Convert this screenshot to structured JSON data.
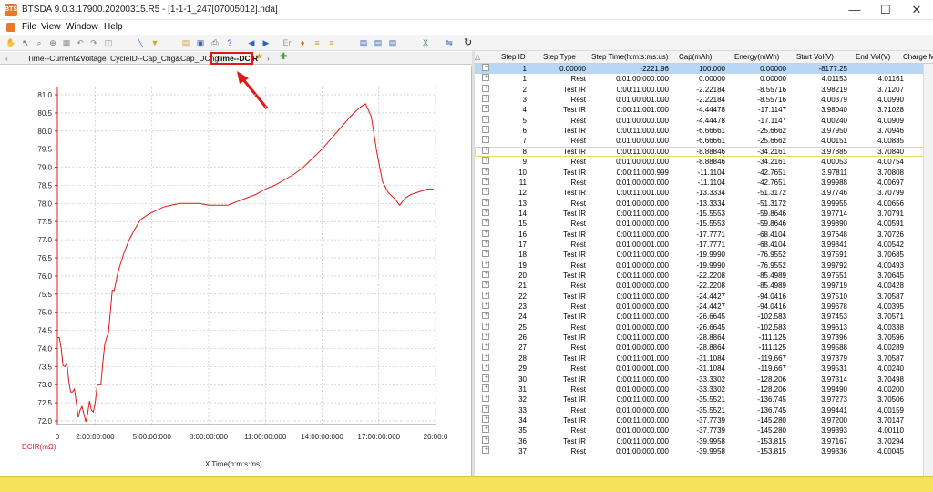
{
  "window": {
    "title": "BTSDA 9.0.3.17900.20200315.R5 - [1-1-1_247[07005012].nda]",
    "icon_label": "BTS",
    "minimize": "—",
    "maximize": "☐",
    "close": "✕"
  },
  "menu": [
    "File",
    "View",
    "Window",
    "Help"
  ],
  "tabs": {
    "items": [
      "Time--Current&Voltage",
      "CycleID--Cap_Chg&Cap_DChg",
      "Time--DCIR"
    ],
    "active": "Time--DCIR"
  },
  "chart_data": {
    "type": "line",
    "xlabel": "X   Time(h:m:s:ms)",
    "ylabel": "DCIR(mΩ)",
    "xlim": [
      0,
      20
    ],
    "ylim": [
      72.0,
      81.0
    ],
    "x_ticks": [
      "0",
      "2:00:00:000",
      "5:00:00:000",
      "8:00:00:000",
      "11:00:00:000",
      "14:00:00:000",
      "17:00:00:000",
      "20:00:0"
    ],
    "y_ticks": [
      "81.0",
      "80.5",
      "80.0",
      "79.5",
      "79.0",
      "78.5",
      "78.0",
      "77.5",
      "77.0",
      "76.5",
      "76.0",
      "75.5",
      "75.0",
      "74.5",
      "74.0",
      "73.5",
      "73.0",
      "72.5",
      "72.0"
    ],
    "series": [
      {
        "color": "#e01818",
        "x": [
          0,
          0.2,
          0.4,
          0.6,
          0.8,
          1.0,
          1.2,
          1.4,
          1.6,
          1.8,
          2.0,
          2.2,
          2.4,
          2.6,
          2.8,
          3.0,
          3.2,
          3.5,
          3.8,
          4.1,
          4.4,
          4.8,
          5.2,
          5.6,
          6.0,
          6.5,
          7.0,
          7.5,
          8.0,
          8.5,
          9.0,
          9.5,
          10.0,
          10.5,
          11.0,
          11.5,
          12.0,
          12.5,
          13.0,
          13.5,
          14.0,
          14.5,
          15.0,
          15.5,
          16.0,
          16.3,
          16.6,
          16.9,
          17.2,
          17.5,
          17.7,
          17.9,
          18.1,
          18.4,
          18.7,
          19.0,
          19.3,
          19.6,
          19.9
        ],
        "y": [
          74.3,
          74.0,
          73.5,
          73.1,
          72.8,
          72.5,
          72.3,
          72.2,
          72.2,
          72.3,
          72.5,
          73.0,
          73.6,
          74.3,
          75.0,
          75.6,
          76.1,
          76.6,
          77.0,
          77.3,
          77.55,
          77.7,
          77.8,
          77.9,
          77.95,
          78.0,
          78.0,
          78.0,
          77.95,
          77.95,
          77.95,
          78.05,
          78.15,
          78.25,
          78.4,
          78.5,
          78.65,
          78.8,
          79.0,
          79.25,
          79.5,
          79.8,
          80.1,
          80.4,
          80.65,
          80.75,
          80.4,
          79.4,
          78.6,
          78.3,
          78.2,
          78.1,
          77.95,
          78.15,
          78.25,
          78.3,
          78.35,
          78.4,
          78.4
        ]
      }
    ]
  },
  "grid": {
    "columns": [
      "Step ID",
      "Step Type",
      "Step Time(h:m:s:ms:us)",
      "Cap(mAh)",
      "Energy(mWh)",
      "Start Vol(V)",
      "End Vol(V)",
      "Charge M"
    ],
    "rows": [
      [
        "1",
        "0.00000",
        "-2221.96",
        "100.000",
        "0.00000",
        "-8177.25",
        ""
      ],
      [
        "1",
        "Rest",
        "0:01:00:000.000",
        "0.00000",
        "0.00000",
        "4.01153",
        "4.01161"
      ],
      [
        "2",
        "Test IR",
        "0:00:11:000.000",
        "-2.22184",
        "-8.55716",
        "3.98219",
        "3.71207"
      ],
      [
        "3",
        "Rest",
        "0:01:00:001.000",
        "-2.22184",
        "-8.55716",
        "4.00379",
        "4.00990"
      ],
      [
        "4",
        "Test IR",
        "0:00:11:001.000",
        "-4.44478",
        "-17.1147",
        "3.98040",
        "3.71028"
      ],
      [
        "5",
        "Rest",
        "0:01:00:000.000",
        "-4.44478",
        "-17.1147",
        "4.00240",
        "4.00909"
      ],
      [
        "6",
        "Test IR",
        "0:00:11:000.000",
        "-6.66661",
        "-25.6662",
        "3.97950",
        "3.70946"
      ],
      [
        "7",
        "Rest",
        "0:01:00:000.000",
        "-6.66661",
        "-25.6662",
        "4.00151",
        "4.00835"
      ],
      [
        "8",
        "Test IR",
        "0:00:11:000.000",
        "-8.88846",
        "-34.2161",
        "3.97885",
        "3.70840"
      ],
      [
        "9",
        "Rest",
        "0:01:00:000.000",
        "-8.88846",
        "-34.2161",
        "4.00053",
        "4.00754"
      ],
      [
        "10",
        "Test IR",
        "0:00:11:000.999",
        "-11.1104",
        "-42.7651",
        "3.97811",
        "3.70808"
      ],
      [
        "11",
        "Rest",
        "0:01:00:000.000",
        "-11.1104",
        "-42.7651",
        "3.99988",
        "4.00697"
      ],
      [
        "12",
        "Test IR",
        "0:00:11:001.000",
        "-13.3334",
        "-51.3172",
        "3.97746",
        "3.70799"
      ],
      [
        "13",
        "Rest",
        "0:01:00:000.000",
        "-13.3334",
        "-51.3172",
        "3.99955",
        "4.00656"
      ],
      [
        "14",
        "Test IR",
        "0:00:11:000.000",
        "-15.5553",
        "-59.8646",
        "3.97714",
        "3.70791"
      ],
      [
        "15",
        "Rest",
        "0:01:00:000.000",
        "-15.5553",
        "-59.8646",
        "3.99890",
        "4.00591"
      ],
      [
        "16",
        "Test IR",
        "0:00:11:000.000",
        "-17.7771",
        "-68.4104",
        "3.97648",
        "3.70726"
      ],
      [
        "17",
        "Rest",
        "0:01:00:001.000",
        "-17.7771",
        "-68.4104",
        "3.99841",
        "4.00542"
      ],
      [
        "18",
        "Test IR",
        "0:00:11:000.000",
        "-19.9990",
        "-76.9552",
        "3.97591",
        "3.70685"
      ],
      [
        "19",
        "Rest",
        "0:01:00:000.000",
        "-19.9990",
        "-76.9552",
        "3.99792",
        "4.00493"
      ],
      [
        "20",
        "Test IR",
        "0:00:11:000.000",
        "-22.2208",
        "-85.4989",
        "3.97551",
        "3.70645"
      ],
      [
        "21",
        "Rest",
        "0:01:00:000.000",
        "-22.2208",
        "-85.4989",
        "3.99719",
        "4.00428"
      ],
      [
        "22",
        "Test IR",
        "0:00:11:000.000",
        "-24.4427",
        "-94.0416",
        "3.97510",
        "3.70587"
      ],
      [
        "23",
        "Rest",
        "0:01:00:000.000",
        "-24.4427",
        "-94.0416",
        "3.99678",
        "4.00395"
      ],
      [
        "24",
        "Test IR",
        "0:00:11:000.000",
        "-26.6645",
        "-102.583",
        "3.97453",
        "3.70571"
      ],
      [
        "25",
        "Rest",
        "0:01:00:000.000",
        "-26.6645",
        "-102.583",
        "3.99613",
        "4.00338"
      ],
      [
        "26",
        "Test IR",
        "0:00:11:000.000",
        "-28.8864",
        "-111.125",
        "3.97396",
        "3.70596"
      ],
      [
        "27",
        "Rest",
        "0:01:00:000.000",
        "-28.8864",
        "-111.125",
        "3.99588",
        "4.00289"
      ],
      [
        "28",
        "Test IR",
        "0:00:11:001.000",
        "-31.1084",
        "-119.667",
        "3.97379",
        "3.70587"
      ],
      [
        "29",
        "Rest",
        "0:01:00:001.000",
        "-31.1084",
        "-119.667",
        "3.99531",
        "4.00240"
      ],
      [
        "30",
        "Test IR",
        "0:00:11:000.000",
        "-33.3302",
        "-128.206",
        "3.97314",
        "3.70498"
      ],
      [
        "31",
        "Rest",
        "0:01:00:000.000",
        "-33.3302",
        "-128.206",
        "3.99490",
        "4.00200"
      ],
      [
        "32",
        "Test IR",
        "0:00:11:000.000",
        "-35.5521",
        "-136.745",
        "3.97273",
        "3.70506"
      ],
      [
        "33",
        "Rest",
        "0:01:00:000.000",
        "-35.5521",
        "-136.745",
        "3.99441",
        "4.00159"
      ],
      [
        "34",
        "Test IR",
        "0:00:11:000.000",
        "-37.7739",
        "-145.280",
        "3.97200",
        "3.70147"
      ],
      [
        "35",
        "Rest",
        "0:01:00:000.000",
        "-37.7739",
        "-145.280",
        "3.99393",
        "4.00110"
      ],
      [
        "36",
        "Test IR",
        "0:00:11:000.000",
        "-39.9958",
        "-153.815",
        "3.97167",
        "3.70294"
      ],
      [
        "37",
        "Rest",
        "0:01:00:000.000",
        "-39.9958",
        "-153.815",
        "3.99336",
        "4.00045"
      ]
    ],
    "selected_row": 0,
    "highlighted_row": 8
  },
  "colors": {
    "accent_red": "#e01818",
    "status_yellow": "#f6e25a",
    "selection_blue": "#b9d6f4"
  }
}
